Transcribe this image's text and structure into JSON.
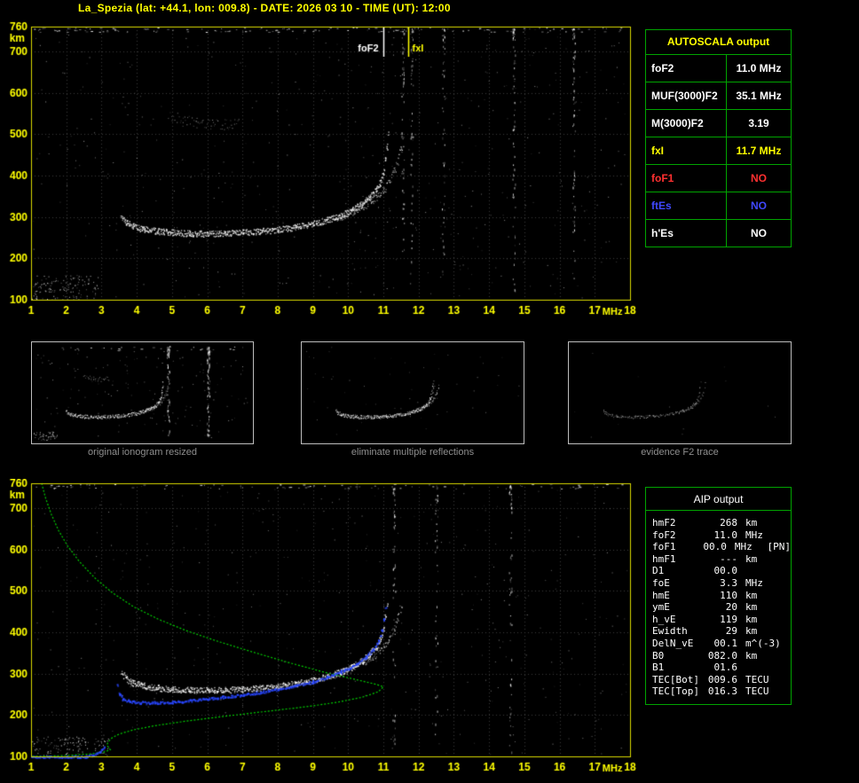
{
  "header": {
    "title": "La_Spezia (lat: +44.1, lon: 009.8) - DATE: 2026 03 10 - TIME (UT): 12:00"
  },
  "colors": {
    "accent_yellow": "#ffff00",
    "grid_green": "#00a400",
    "trace_white": "#ffffff",
    "profile_green": "#00cc00",
    "restored_blue": "#2846ff",
    "alert_red": "#ff3030",
    "es_blue": "#4048ff",
    "caption_gray": "#8f8f8f"
  },
  "autoscala": {
    "title": "AUTOSCALA output",
    "rows": [
      {
        "label": "foF2",
        "value": "11.0 MHz",
        "color": "#ffffff"
      },
      {
        "label": "MUF(3000)F2",
        "value": "35.1 MHz",
        "color": "#ffffff"
      },
      {
        "label": "M(3000)F2",
        "value": "3.19",
        "color": "#ffffff"
      },
      {
        "label": "fxI",
        "value": "11.7 MHz",
        "color": "#ffff00"
      },
      {
        "label": "foF1",
        "value": "NO",
        "color": "#ff3030"
      },
      {
        "label": "ftEs",
        "value": "NO",
        "color": "#4048ff"
      },
      {
        "label": "h'Es",
        "value": "NO",
        "color": "#ffffff"
      }
    ]
  },
  "thumbnails": [
    {
      "caption": "original ionogram resized"
    },
    {
      "caption": "eliminate multiple reflections"
    },
    {
      "caption": "evidence F2 trace"
    }
  ],
  "aip": {
    "title": "AIP output",
    "rows": [
      {
        "name": "hmF2",
        "value": "268",
        "unit": "km",
        "extra": ""
      },
      {
        "name": "foF2",
        "value": "11.0",
        "unit": "MHz",
        "extra": ""
      },
      {
        "name": "foF1",
        "value": "00.0",
        "unit": "MHz",
        "extra": "[PN]"
      },
      {
        "name": "hmF1",
        "value": "---",
        "unit": "km",
        "extra": ""
      },
      {
        "name": "D1",
        "value": "00.0",
        "unit": "",
        "extra": ""
      },
      {
        "name": "foE",
        "value": "3.3",
        "unit": "MHz",
        "extra": ""
      },
      {
        "name": "hmE",
        "value": "110",
        "unit": "km",
        "extra": ""
      },
      {
        "name": "ymE",
        "value": "20",
        "unit": "km",
        "extra": ""
      },
      {
        "name": "h_vE",
        "value": "119",
        "unit": "km",
        "extra": ""
      },
      {
        "name": "Ewidth",
        "value": "29",
        "unit": "km",
        "extra": ""
      },
      {
        "name": "DelN_vE",
        "value": "00.1",
        "unit": "m^(-3)",
        "extra": ""
      },
      {
        "name": "B0",
        "value": "082.0",
        "unit": "km",
        "extra": ""
      },
      {
        "name": "B1",
        "value": "01.6",
        "unit": "",
        "extra": ""
      },
      {
        "name": "TEC[Bot]",
        "value": "009.6",
        "unit": "TECU",
        "extra": ""
      },
      {
        "name": "TEC[Top]",
        "value": "016.3",
        "unit": "TECU",
        "extra": ""
      }
    ]
  },
  "chart_data": [
    {
      "id": "main_ionogram",
      "type": "scatter",
      "title": "",
      "xlabel": "MHz",
      "ylabel": "km",
      "xlim": [
        1,
        18
      ],
      "ylim": [
        100,
        760
      ],
      "xticks": [
        1,
        2,
        3,
        4,
        5,
        6,
        7,
        8,
        9,
        10,
        11,
        12,
        13,
        14,
        15,
        16,
        17,
        18
      ],
      "yticks": [
        100,
        200,
        300,
        400,
        500,
        600,
        700,
        760
      ],
      "grid": "dotted",
      "legend": "none",
      "annotations": [
        {
          "label": "foF2",
          "freq_mhz": 11.0,
          "color": "#ffffff"
        },
        {
          "label": "fxI",
          "freq_mhz": 11.7,
          "color": "#ffff00"
        }
      ],
      "series": [
        {
          "name": "f2-ordinary-trace",
          "color": "#ffffff",
          "points": [
            [
              3.55,
              305
            ],
            [
              3.7,
              288
            ],
            [
              3.9,
              278
            ],
            [
              4.2,
              271
            ],
            [
              4.6,
              266
            ],
            [
              5.0,
              263
            ],
            [
              5.5,
              261
            ],
            [
              6.0,
              260
            ],
            [
              6.5,
              261
            ],
            [
              7.0,
              263
            ],
            [
              7.5,
              266
            ],
            [
              8.0,
              270
            ],
            [
              8.5,
              276
            ],
            [
              9.0,
              284
            ],
            [
              9.4,
              293
            ],
            [
              9.8,
              305
            ],
            [
              10.1,
              317
            ],
            [
              10.4,
              332
            ],
            [
              10.6,
              347
            ],
            [
              10.8,
              366
            ],
            [
              10.9,
              383
            ],
            [
              11.0,
              408
            ],
            [
              11.05,
              438
            ],
            [
              11.1,
              470
            ],
            [
              11.13,
              500
            ]
          ]
        },
        {
          "name": "f2-extraordinary-trace",
          "color": "#ffffff",
          "points": [
            [
              9.6,
              298
            ],
            [
              9.9,
              306
            ],
            [
              10.2,
              317
            ],
            [
              10.5,
              331
            ],
            [
              10.8,
              349
            ],
            [
              11.0,
              366
            ],
            [
              11.15,
              386
            ],
            [
              11.3,
              410
            ],
            [
              11.4,
              436
            ],
            [
              11.5,
              465
            ],
            [
              11.55,
              495
            ]
          ]
        },
        {
          "name": "second-hop-echo",
          "color": "#ffffff",
          "points": [
            [
              4.9,
              548
            ],
            [
              5.3,
              535
            ],
            [
              5.7,
              527
            ],
            [
              6.1,
              523
            ],
            [
              6.5,
              524
            ],
            [
              6.9,
              530
            ]
          ]
        }
      ],
      "noise": {
        "background_dots": 520,
        "rfi_streak_freqs": [
          11.55,
          11.8,
          12.7,
          14.7,
          16.4
        ]
      }
    },
    {
      "id": "restored_ionogram",
      "type": "scatter",
      "title": "",
      "xlabel": "MHz",
      "ylabel": "km",
      "xlim": [
        1,
        18
      ],
      "ylim": [
        100,
        760
      ],
      "xticks": [
        1,
        2,
        3,
        4,
        5,
        6,
        7,
        8,
        9,
        10,
        11,
        12,
        13,
        14,
        15,
        16,
        17,
        18
      ],
      "yticks": [
        100,
        200,
        300,
        400,
        500,
        600,
        700,
        760
      ],
      "grid": "dotted",
      "legend": "none",
      "annotations": [],
      "series": [
        {
          "name": "f2-ordinary-trace",
          "color": "#ffffff",
          "points": [
            [
              3.55,
              305
            ],
            [
              3.7,
              288
            ],
            [
              3.9,
              278
            ],
            [
              4.2,
              271
            ],
            [
              4.6,
              266
            ],
            [
              5.0,
              263
            ],
            [
              5.5,
              261
            ],
            [
              6.0,
              260
            ],
            [
              6.5,
              261
            ],
            [
              7.0,
              263
            ],
            [
              7.5,
              266
            ],
            [
              8.0,
              270
            ],
            [
              8.5,
              276
            ],
            [
              9.0,
              284
            ],
            [
              9.4,
              293
            ],
            [
              9.8,
              305
            ],
            [
              10.1,
              317
            ],
            [
              10.4,
              332
            ],
            [
              10.6,
              347
            ],
            [
              10.8,
              366
            ],
            [
              10.9,
              383
            ],
            [
              11.0,
              408
            ],
            [
              11.05,
              438
            ],
            [
              11.1,
              470
            ]
          ]
        },
        {
          "name": "f2-extraordinary-trace",
          "color": "#ffffff",
          "points": [
            [
              9.6,
              298
            ],
            [
              9.9,
              306
            ],
            [
              10.2,
              317
            ],
            [
              10.5,
              331
            ],
            [
              10.8,
              349
            ],
            [
              11.0,
              366
            ],
            [
              11.15,
              386
            ],
            [
              11.3,
              410
            ],
            [
              11.4,
              436
            ],
            [
              11.5,
              465
            ]
          ]
        },
        {
          "name": "restored-trace",
          "color": "#2846ff",
          "points": [
            [
              3.45,
              275
            ],
            [
              3.5,
              252
            ],
            [
              3.6,
              240
            ],
            [
              3.8,
              234
            ],
            [
              4.1,
              231
            ],
            [
              4.5,
              231
            ],
            [
              5.0,
              233
            ],
            [
              5.5,
              236
            ],
            [
              6.0,
              240
            ],
            [
              6.5,
              245
            ],
            [
              7.0,
              250
            ],
            [
              7.5,
              256
            ],
            [
              8.0,
              263
            ],
            [
              8.5,
              271
            ],
            [
              9.0,
              281
            ],
            [
              9.4,
              292
            ],
            [
              9.8,
              306
            ],
            [
              10.2,
              323
            ],
            [
              10.5,
              342
            ],
            [
              10.7,
              360
            ],
            [
              10.85,
              381
            ],
            [
              10.95,
              405
            ],
            [
              11.0,
              432
            ],
            [
              11.05,
              460
            ]
          ]
        },
        {
          "name": "restored-e-region",
          "color": "#2846ff",
          "points": [
            [
              1.0,
              100
            ],
            [
              1.5,
              100
            ],
            [
              2.0,
              100
            ],
            [
              2.55,
              100
            ],
            [
              2.75,
              104
            ],
            [
              2.95,
              112
            ],
            [
              3.05,
              122
            ]
          ]
        },
        {
          "name": "electron-density-profile",
          "color": "#00cc00",
          "points": [
            [
              1.3,
              760
            ],
            [
              1.42,
              722
            ],
            [
              1.58,
              684
            ],
            [
              1.78,
              646
            ],
            [
              2.04,
              608
            ],
            [
              2.38,
              570
            ],
            [
              2.8,
              532
            ],
            [
              3.3,
              496
            ],
            [
              3.9,
              462
            ],
            [
              4.6,
              432
            ],
            [
              5.4,
              404
            ],
            [
              6.3,
              378
            ],
            [
              7.3,
              352
            ],
            [
              8.3,
              327
            ],
            [
              9.3,
              304
            ],
            [
              10.2,
              286
            ],
            [
              10.8,
              274
            ],
            [
              11.0,
              268
            ],
            [
              10.85,
              256
            ],
            [
              10.4,
              243
            ],
            [
              9.7,
              231
            ],
            [
              8.9,
              221
            ],
            [
              8.0,
              212
            ],
            [
              7.1,
              203
            ],
            [
              6.2,
              194
            ],
            [
              5.3,
              184
            ],
            [
              4.5,
              174
            ],
            [
              3.9,
              164
            ],
            [
              3.5,
              154
            ],
            [
              3.3,
              145
            ],
            [
              3.2,
              136
            ],
            [
              3.15,
              128
            ],
            [
              3.2,
              121
            ],
            [
              3.25,
              116
            ],
            [
              3.05,
              110
            ],
            [
              2.7,
              106
            ],
            [
              2.2,
              103
            ],
            [
              1.6,
              101
            ],
            [
              1.0,
              100
            ]
          ]
        }
      ],
      "noise": {
        "background_dots": 420,
        "rfi_streak_freqs": [
          11.3,
          12.5,
          14.6
        ]
      }
    }
  ]
}
